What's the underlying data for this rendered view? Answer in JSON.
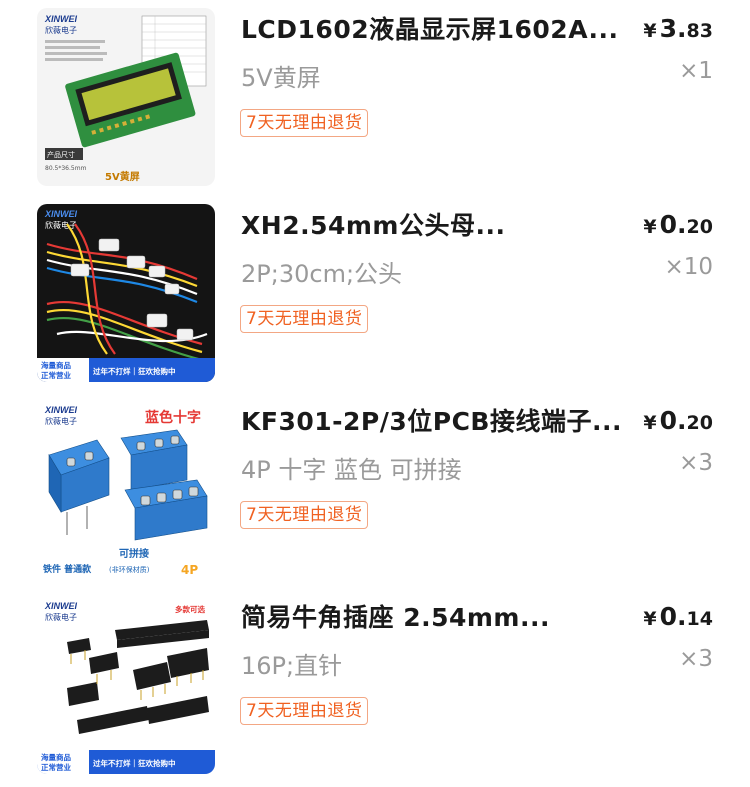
{
  "items": [
    {
      "title": "LCD1602液晶显示屏1602A...",
      "spec": "5V黄屏",
      "price_currency": "¥",
      "price_int": "3.",
      "price_dec": "83",
      "qty": "×1",
      "tag": "7天无理由退货",
      "image_texts": {
        "brand": "XINWEI",
        "brand_cn": "欣薇电子",
        "caption": "5V黄屏",
        "size_label": "产品尺寸",
        "size_value": "80.5*36.5mm"
      }
    },
    {
      "title": "XH2.54mm公头母...",
      "spec": "2P;30cm;公头",
      "price_currency": "¥",
      "price_int": "0.",
      "price_dec": "20",
      "qty": "×10",
      "tag": "7天无理由退货",
      "image_texts": {
        "brand": "XINWEI",
        "brand_cn": "欣薇电子",
        "banner_left1": "海量商品",
        "banner_left2": "正常营业",
        "banner_right": "过年不打烊｜狂欢抢购中"
      }
    },
    {
      "title": "KF301-2P/3位PCB接线端子...",
      "spec": "4P 十字 蓝色 可拼接",
      "price_currency": "¥",
      "price_int": "0.",
      "price_dec": "20",
      "qty": "×3",
      "tag": "7天无理由退货",
      "image_texts": {
        "brand": "XINWEI",
        "brand_cn": "欣薇电子",
        "headline": "蓝色十字",
        "mid": "可拼接",
        "bottom_left": "铁件 普通款",
        "bottom_mid": "(非环保材质)",
        "bottom_right": "4P"
      }
    },
    {
      "title": "简易牛角插座 2.54mm...",
      "spec": "16P;直针",
      "price_currency": "¥",
      "price_int": "0.",
      "price_dec": "14",
      "qty": "×3",
      "tag": "7天无理由退货",
      "image_texts": {
        "brand": "XINWEI",
        "brand_cn": "欣薇电子",
        "corner": "多款可选",
        "banner_left1": "海量商品",
        "banner_left2": "正常营业",
        "banner_right": "过年不打烊｜狂欢抢购中"
      }
    }
  ],
  "colors": {
    "tag_text": "#f06121",
    "tag_border": "#f3a784",
    "muted": "#9a9a9a",
    "title": "#1a1a1a"
  }
}
